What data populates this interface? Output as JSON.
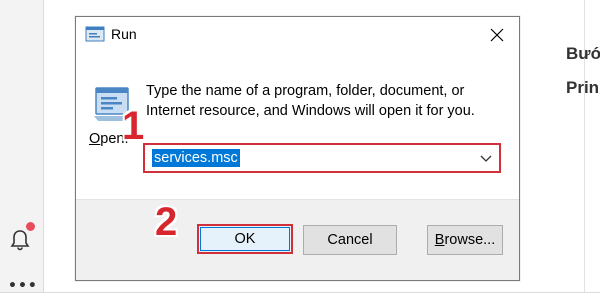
{
  "dialog": {
    "title": "Run",
    "description": "Type the name of a program, folder, document, or Internet resource, and Windows will open it for you.",
    "open_label_mnemonic": "O",
    "open_label_rest": "pen:",
    "open_value": "services.msc",
    "buttons": {
      "ok": "OK",
      "cancel": "Cancel",
      "browse_mnemonic": "B",
      "browse_rest": "rowse..."
    }
  },
  "annotations": {
    "step1": "1",
    "step2": "2"
  },
  "background": {
    "heading_1": "Bướ",
    "heading_2": "Prin",
    "dots": "•••"
  },
  "colors": {
    "highlight_red": "#d0303a",
    "selection_blue": "#0078d7",
    "notification_badge": "#e84d5b"
  },
  "icons": [
    "run-app-icon",
    "run-program-icon",
    "close-icon",
    "chevron-down-icon",
    "bell-icon",
    "more-icon"
  ]
}
